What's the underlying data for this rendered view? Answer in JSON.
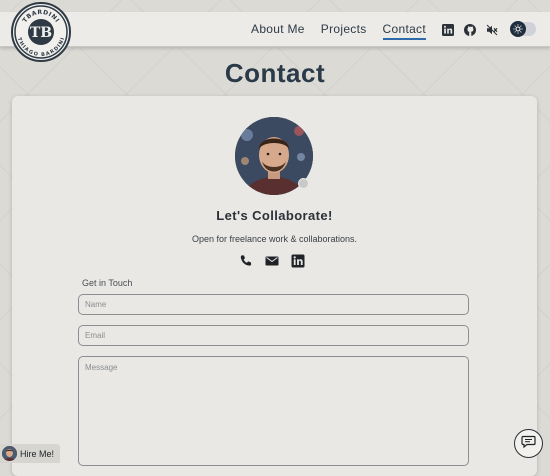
{
  "logo": {
    "top_text": "TBARDINI",
    "bottom_text": "THIAGO BARDINI",
    "monogram": "TB"
  },
  "nav": {
    "links": [
      {
        "label": "About Me"
      },
      {
        "label": "Projects"
      },
      {
        "label": "Contact",
        "active": true
      }
    ],
    "icons": [
      "linkedin-icon",
      "github-icon",
      "sound-muted-icon"
    ],
    "theme_toggle": {
      "icon": "sun-icon",
      "state": "off"
    }
  },
  "page": {
    "title": "Contact"
  },
  "card": {
    "heading": "Let's Collaborate!",
    "subtitle": "Open for freelance work & collaborations.",
    "contact_icons": [
      "phone-icon",
      "mail-icon",
      "linkedin-icon"
    ],
    "form": {
      "title": "Get in Touch",
      "name_placeholder": "Name",
      "email_placeholder": "Email",
      "message_placeholder": "Message"
    }
  },
  "hire_button": {
    "label": "Hire Me!"
  },
  "chat_button": {
    "icon": "chat-icon"
  },
  "colors": {
    "accent": "#2e6aa8",
    "text": "#2b3a49",
    "card": "#e9e8e4",
    "background": "#dcdad5"
  }
}
